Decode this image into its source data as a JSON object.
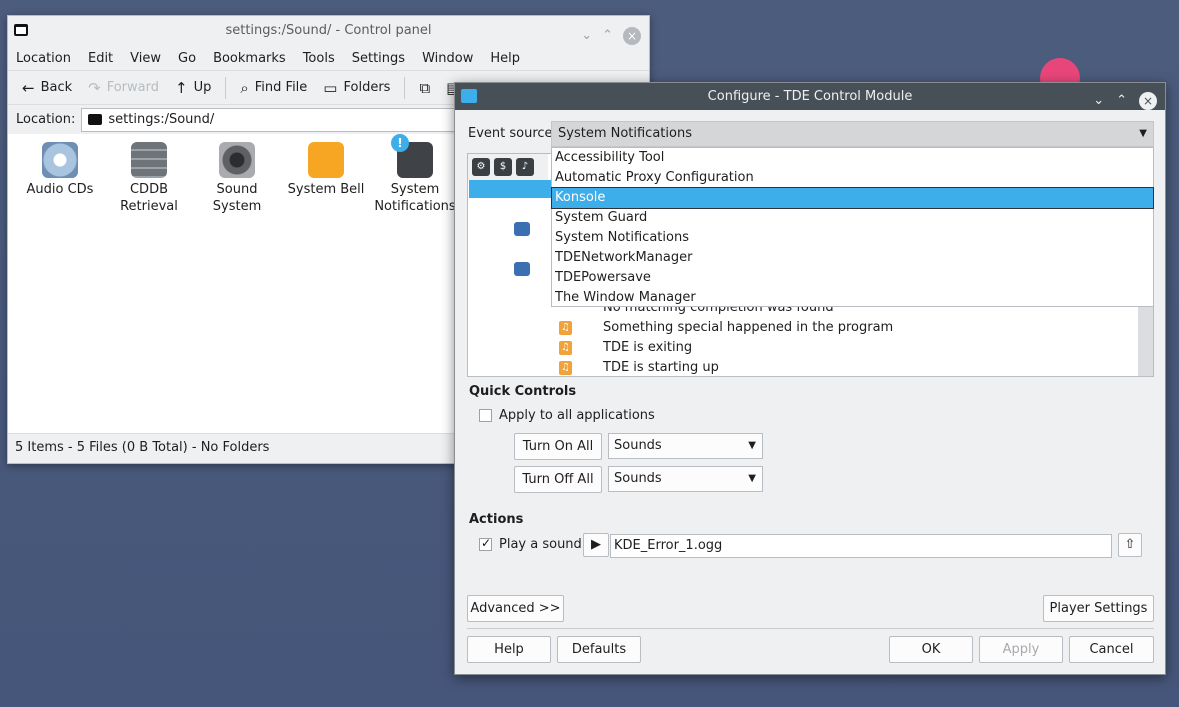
{
  "file_manager": {
    "title": "settings:/Sound/ - Control panel",
    "menu": [
      {
        "label": "Location"
      },
      {
        "label": "Edit"
      },
      {
        "label": "View"
      },
      {
        "label": "Go"
      },
      {
        "label": "Bookmarks"
      },
      {
        "label": "Tools"
      },
      {
        "label": "Settings"
      },
      {
        "label": "Window"
      },
      {
        "label": "Help"
      }
    ],
    "toolbar": {
      "back": "Back",
      "forward": "Forward",
      "up": "Up",
      "find_file": "Find File",
      "folders": "Folders"
    },
    "location_label": "Location:",
    "location_value": "settings:/Sound/",
    "icons": [
      {
        "label": "Audio CDs",
        "icon": "audio-cd-icon"
      },
      {
        "label": "CDDB Retrieval",
        "icon": "server-rack-icon"
      },
      {
        "label": "Sound System",
        "icon": "speaker-icon"
      },
      {
        "label": "System Bell",
        "icon": "bell-icon"
      },
      {
        "label": "System Notifications",
        "icon": "notification-icon"
      }
    ],
    "status": "5 Items - 5 Files (0 B Total) - No Folders"
  },
  "dialog": {
    "title": "Configure - TDE Control Module",
    "event_source_label": "Event source:",
    "event_source_value": "System Notifications",
    "dropdown_options": [
      {
        "label": "Accessibility Tool"
      },
      {
        "label": "Automatic Proxy Configuration"
      },
      {
        "label": "Konsole",
        "highlighted": true
      },
      {
        "label": "System Guard"
      },
      {
        "label": "System Notifications"
      },
      {
        "label": "TDENetworkManager"
      },
      {
        "label": "TDEPowersave"
      },
      {
        "label": "The Window Manager"
      }
    ],
    "events_visible": [
      {
        "label": "No matching completion was found"
      },
      {
        "label": "Something special happened in the program"
      },
      {
        "label": "TDE is exiting"
      },
      {
        "label": "TDE is starting up"
      }
    ],
    "quick_controls": {
      "heading": "Quick Controls",
      "apply_all_label": "Apply to all applications",
      "apply_all_checked": false,
      "turn_on_all": "Turn On All",
      "turn_on_select": "Sounds",
      "turn_off_all": "Turn Off All",
      "turn_off_select": "Sounds"
    },
    "actions": {
      "heading": "Actions",
      "play_sound_label": "Play a sound:",
      "play_sound_checked": true,
      "sound_file": "KDE_Error_1.ogg"
    },
    "buttons": {
      "advanced": "Advanced >>",
      "player_settings": "Player Settings",
      "help": "Help",
      "defaults": "Defaults",
      "ok": "OK",
      "apply": "Apply",
      "cancel": "Cancel"
    },
    "colors": {
      "accent": "#3daee9",
      "titlebar": "#475057"
    }
  }
}
